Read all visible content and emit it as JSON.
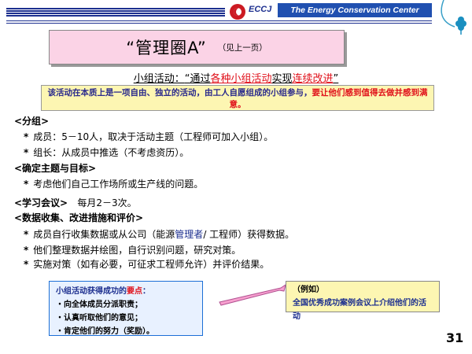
{
  "header": {
    "logo_text": "ECCJ",
    "org_name": "The Energy Conservation Center Japan"
  },
  "title": {
    "main": "“管理圈A”",
    "note": "（见上一页）"
  },
  "subtitle": {
    "prefix": "小组活动：",
    "q_open": "“通过",
    "part1": "各种小组活动",
    "mid": "实现",
    "part2": "连续改进",
    "q_close": "”"
  },
  "intro_box": {
    "part1": "该活动在本质上是一项自由、独立的活动，由",
    "part2": "工人自愿组成的小组参与，",
    "part3": "要让他们感到值得去做并感到满意。"
  },
  "sections": {
    "group": {
      "heading": "<分组>",
      "item1": "成员：5－10人，取决于活动主题（工程师可加入小组）。",
      "item2": "组长：从成员中推选（不考虑资历）。"
    },
    "theme": {
      "heading": "<确定主题与目标>",
      "item1": "考虑他们自己工作场所或生产线的问题。"
    },
    "meeting": {
      "heading": "<学习会议>",
      "text": "每月2－3次。"
    },
    "data": {
      "heading": "<数据收集、改进措施和评价>",
      "item1_a": "成员自行收集数据或从公司（能源",
      "item1_b": "管理者",
      "item1_c": "/ 工程师）获得数据。",
      "item2": "他们整理数据并绘图，自行识别问题，研究对策。",
      "item3": "实施对策（如有必要，可征求工程师允许）并评价结果。"
    }
  },
  "callout_left": {
    "title_a": "小组活动获得成功的",
    "title_b": "要点",
    "title_c": "：",
    "items": [
      "・向全体成员分派职责；",
      "・认真听取他们的意见；",
      "・肯定他们的努力（奖励）。"
    ]
  },
  "callout_right": {
    "label": "（例如）",
    "text": "全国优秀成功案例会议上介绍他们的活动"
  },
  "bullet": "*",
  "page_number": "31",
  "colors": {
    "header_blue": "#1c2f8f",
    "accent_red": "#e0101a",
    "title_pink": "#fbd3e6",
    "note_yellow": "#fdf6b2"
  }
}
